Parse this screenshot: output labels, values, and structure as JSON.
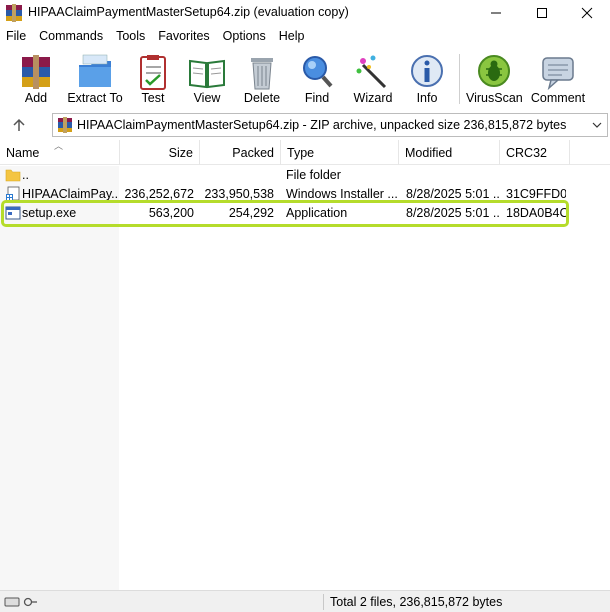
{
  "window": {
    "title": "HIPAAClaimPaymentMasterSetup64.zip (evaluation copy)"
  },
  "menu": [
    "File",
    "Commands",
    "Tools",
    "Favorites",
    "Options",
    "Help"
  ],
  "toolbar": {
    "add": "Add",
    "extract": "Extract To",
    "test": "Test",
    "view": "View",
    "delete": "Delete",
    "find": "Find",
    "wizard": "Wizard",
    "info": "Info",
    "virusscan": "VirusScan",
    "comment": "Comment"
  },
  "address": {
    "text": "HIPAAClaimPaymentMasterSetup64.zip - ZIP archive, unpacked size 236,815,872 bytes"
  },
  "columns": {
    "name": "Name",
    "size": "Size",
    "packed": "Packed",
    "type": "Type",
    "modified": "Modified",
    "crc": "CRC32"
  },
  "rows": [
    {
      "name": "..",
      "size": "",
      "packed": "",
      "type": "File folder",
      "modified": "",
      "crc": "",
      "icon": "folder-icon"
    },
    {
      "name": "HIPAAClaimPay...",
      "size": "236,252,672",
      "packed": "233,950,538",
      "type": "Windows Installer ...",
      "modified": "8/28/2025 5:01 ...",
      "crc": "31C9FFD0",
      "icon": "msi-installer-icon"
    },
    {
      "name": "setup.exe",
      "size": "563,200",
      "packed": "254,292",
      "type": "Application",
      "modified": "8/28/2025 5:01 ...",
      "crc": "18DA0B4C",
      "icon": "exe-application-icon"
    }
  ],
  "status": {
    "text": "Total 2 files, 236,815,872 bytes"
  },
  "colors": {
    "highlight": "#b5dc2b"
  }
}
